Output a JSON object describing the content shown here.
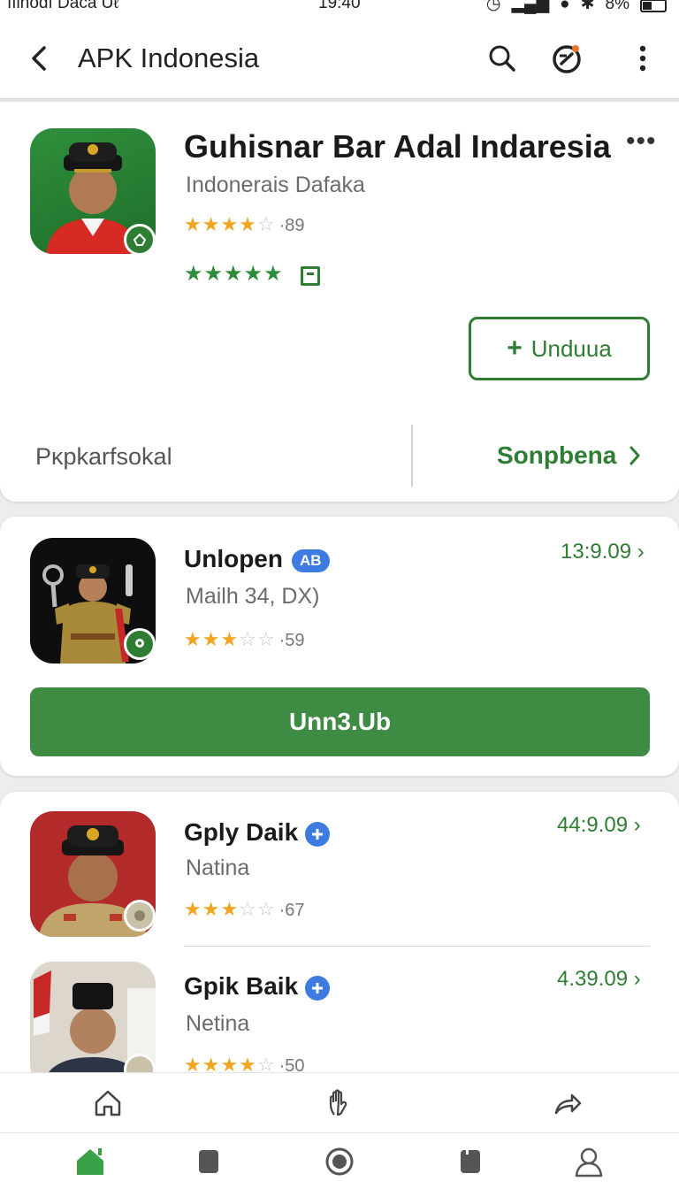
{
  "status_bar": {
    "carrier": "ıılnodı Daca Uℓ",
    "time": "19:40",
    "battery": "8%"
  },
  "app_bar": {
    "title": "APK Indonesia"
  },
  "featured": {
    "name": "Guhisnar Bar Adal Indaresia",
    "developer": "Indonerais Dafaka",
    "rating_stars": "★★★★",
    "rating_empty": "☆",
    "rating_count": "·89",
    "green_stars": "★★★★★",
    "install_label": "Unduua",
    "footer_left": "Pĸpkarfsokal",
    "footer_right": "Sonpbena"
  },
  "apps": [
    {
      "name": "Unlopen",
      "tag": "AB",
      "sub": "Mailh 34, DX)",
      "stars_on": "★★★",
      "stars_off": "☆☆",
      "count": "·59",
      "size": "13:9.09",
      "button": "Unn3.Ub"
    },
    {
      "name": "Gply Daik",
      "sub": "Natina",
      "stars_on": "★★★",
      "stars_off": "☆☆",
      "count": "·67",
      "size": "44:9.09"
    },
    {
      "name": "Gpik Baik",
      "sub": "Netina",
      "stars_on": "★★★★",
      "stars_off": "☆",
      "count": "·50",
      "size": "4.39.09"
    }
  ],
  "colors": {
    "accent_green": "#2e7d32",
    "star": "#f0a623",
    "badge_blue": "#3d7be0"
  }
}
